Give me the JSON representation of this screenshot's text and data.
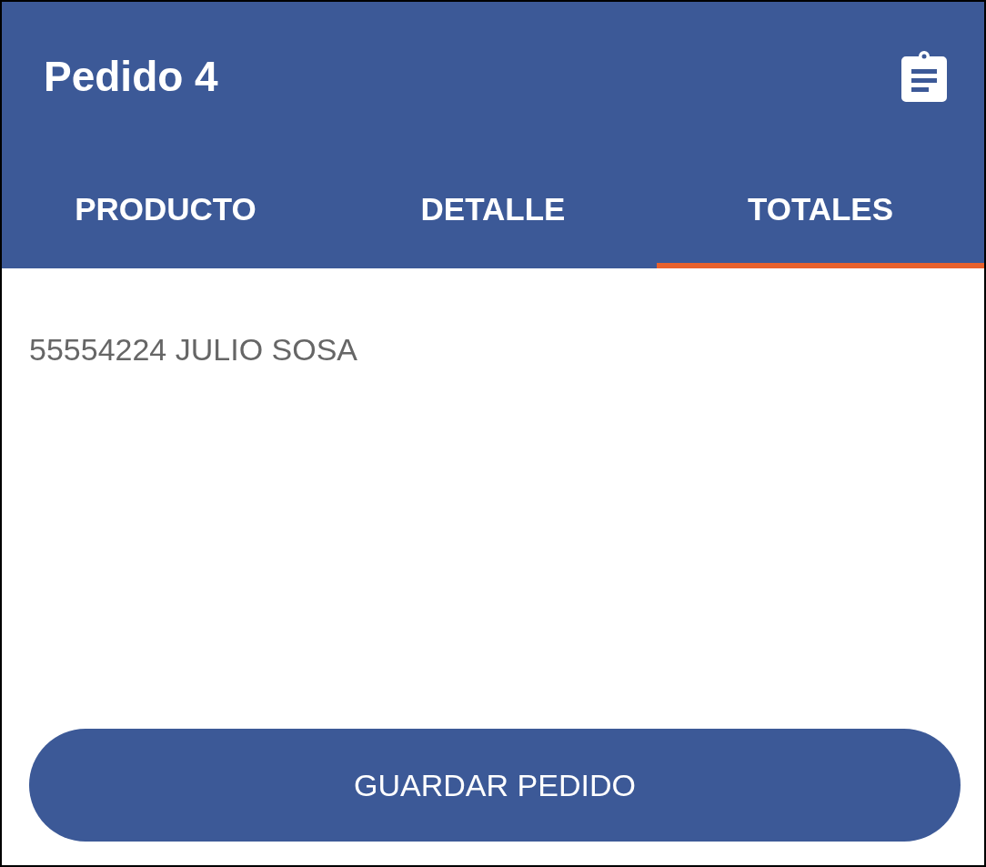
{
  "app_bar": {
    "title": "Pedido 4"
  },
  "tabs": [
    {
      "label": "PRODUCTO",
      "selected": false
    },
    {
      "label": "DETALLE",
      "selected": false
    },
    {
      "label": "TOTALES",
      "selected": true
    }
  ],
  "customer": "55554224 JULIO SOSA",
  "save_button": "GUARDAR PEDIDO"
}
